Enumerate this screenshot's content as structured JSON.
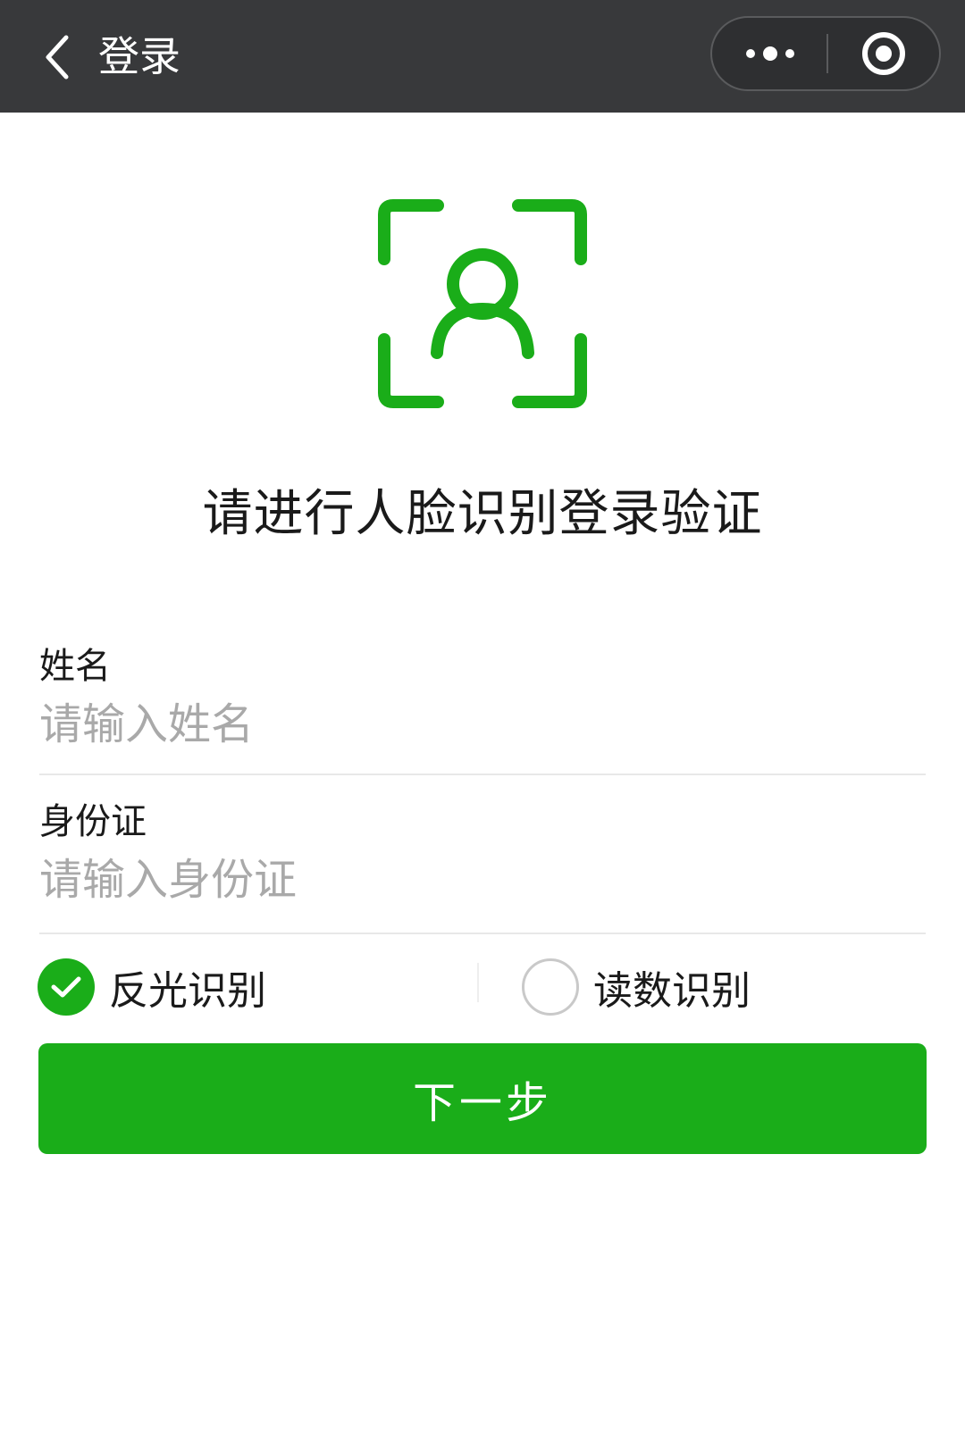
{
  "nav": {
    "title": "登录",
    "back_icon": "chevron-left-icon",
    "more_icon": "more-dots-icon",
    "close_icon": "circle-target-icon"
  },
  "face": {
    "icon": "face-recognition-icon",
    "color": "#1aad19"
  },
  "prompt": "请进行人脸识别登录验证",
  "form": {
    "name": {
      "label": "姓名",
      "placeholder": "请输入姓名",
      "value": ""
    },
    "id_card": {
      "label": "身份证",
      "placeholder": "请输入身份证",
      "value": ""
    }
  },
  "options": [
    {
      "label": "反光识别",
      "selected": true
    },
    {
      "label": "读数识别",
      "selected": false
    }
  ],
  "next_button": "下一步",
  "colors": {
    "accent": "#1aad19",
    "navbar": "#38393b",
    "placeholder": "#a9a9a9",
    "divider": "#e8e8e8"
  }
}
